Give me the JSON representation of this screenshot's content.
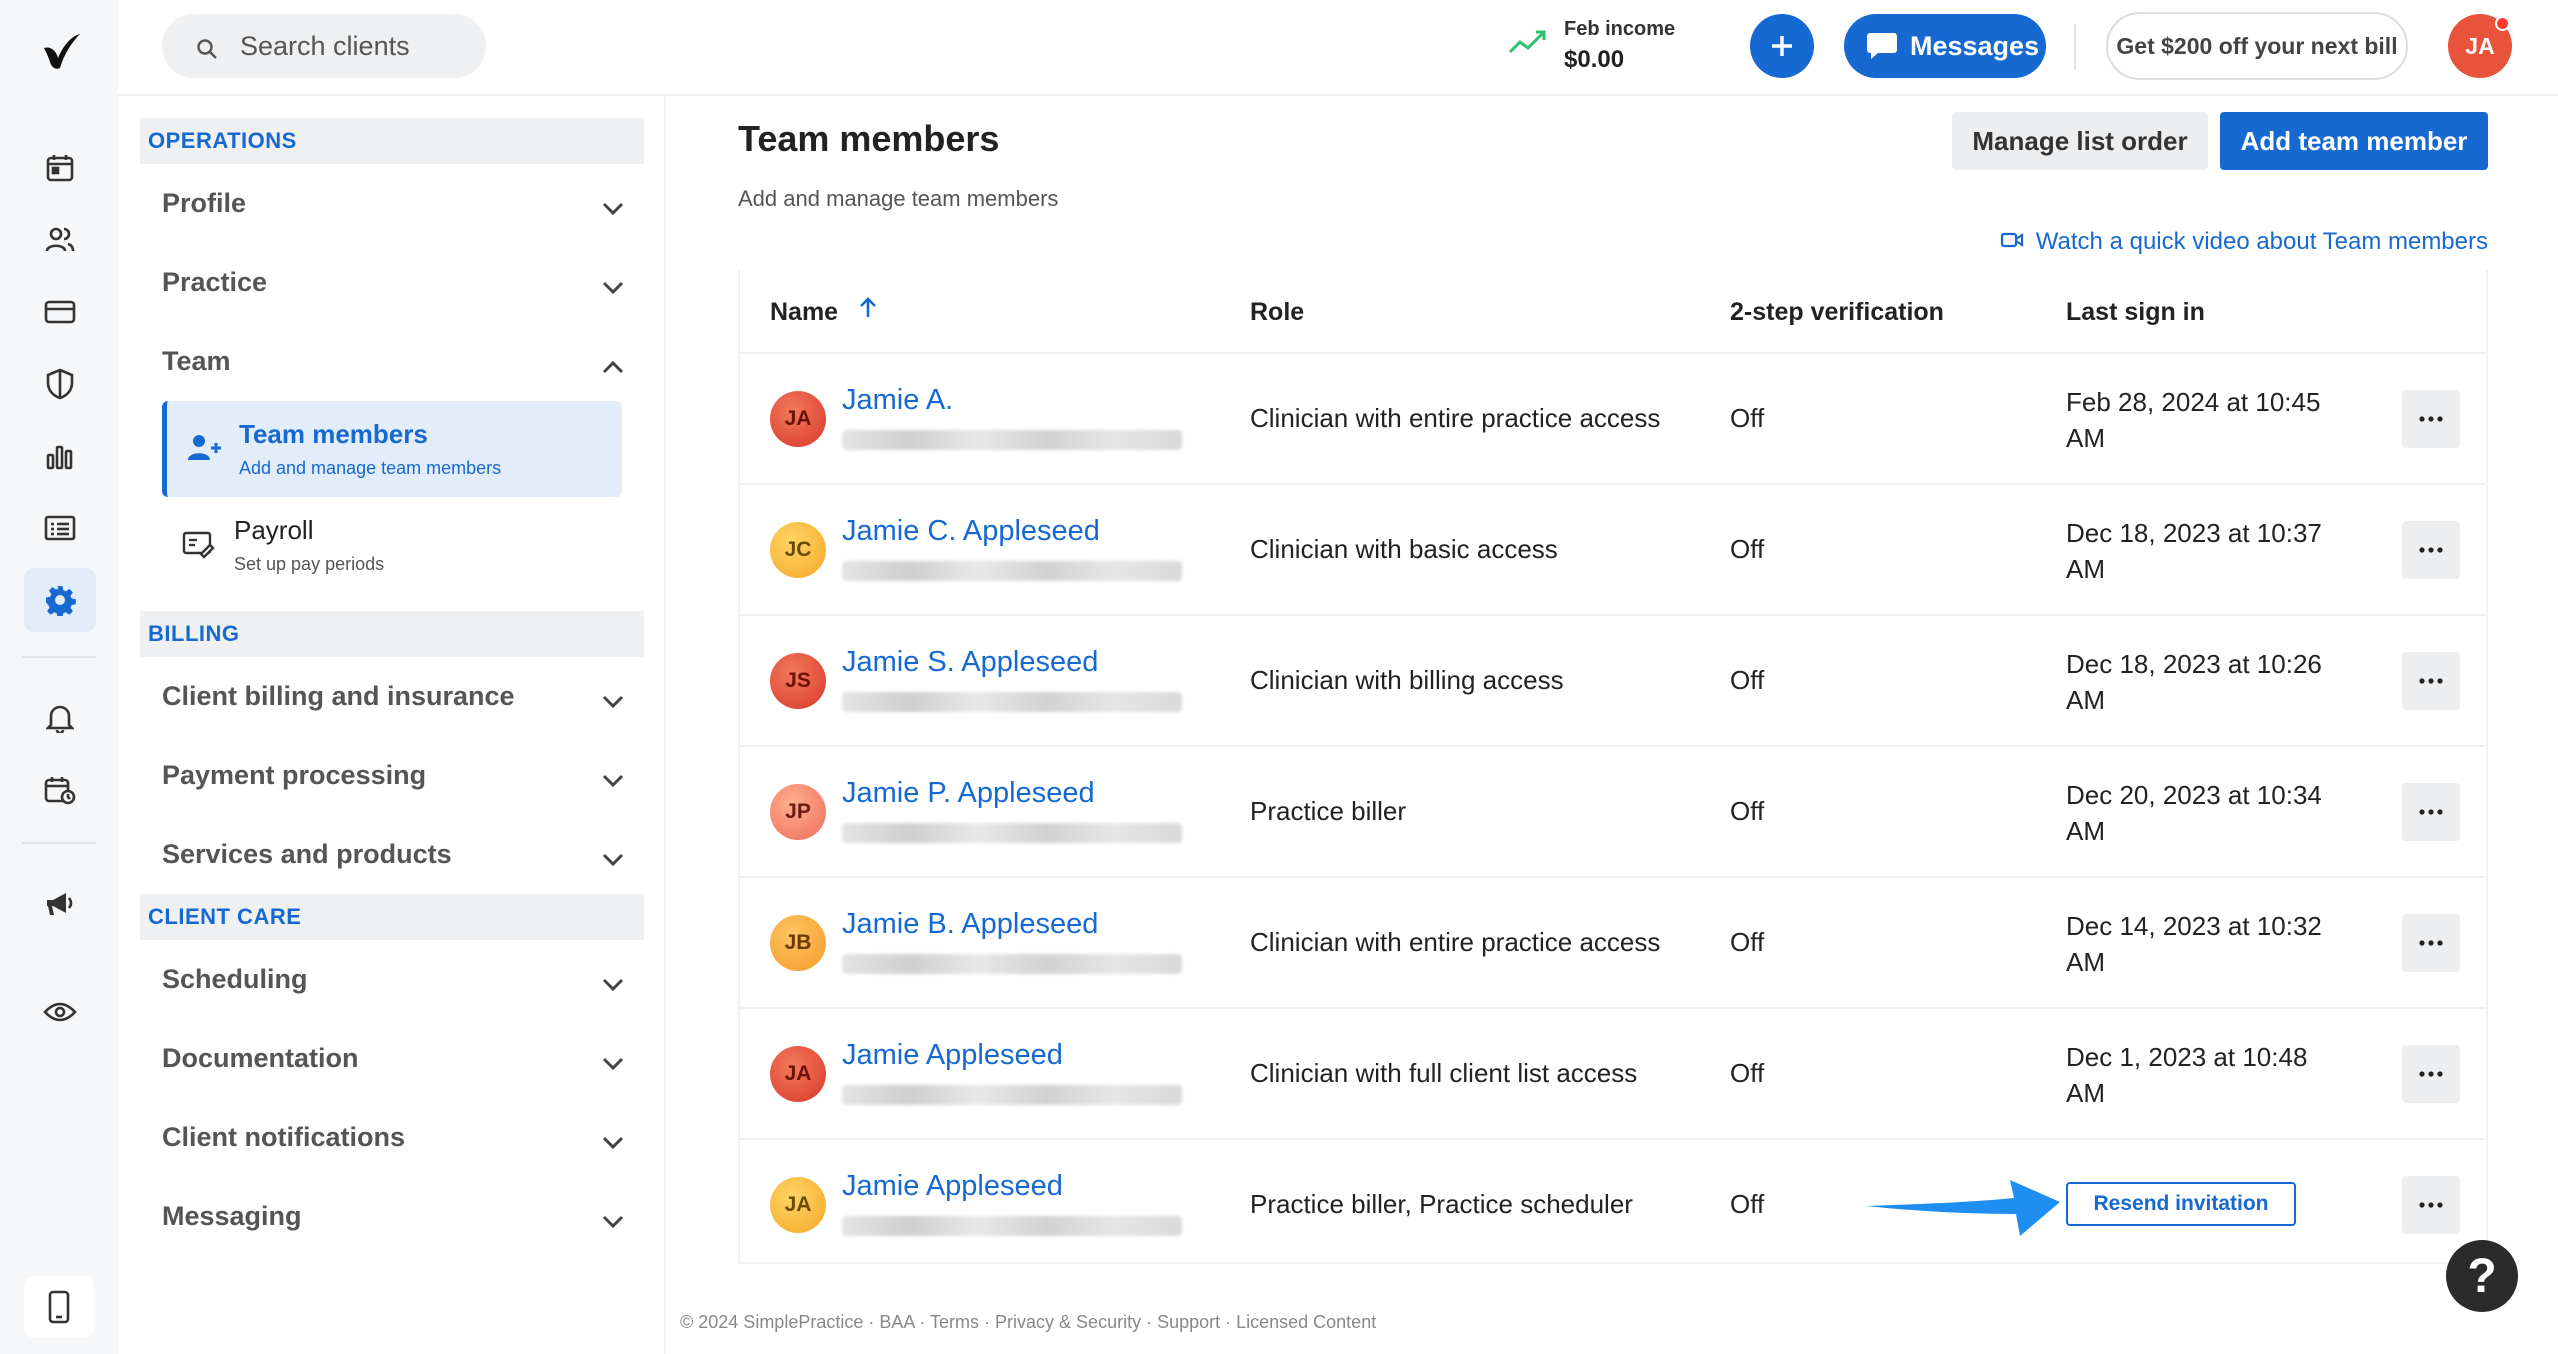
{
  "colors": {
    "accent": "#1669d0",
    "rail_bg": "#f6f7f8",
    "income_trend": "#2fbf71"
  },
  "rail": {
    "icons": [
      "logo-icon",
      "calendar-icon",
      "clients-icon",
      "billing-card-icon",
      "insurance-shield-icon",
      "analytics-icon",
      "list-icon",
      "settings-gear-icon",
      "bell-icon",
      "calendar-request-icon",
      "megaphone-icon",
      "eye-icon",
      "mobile-phone-icon"
    ],
    "active": "settings-gear-icon"
  },
  "topbar": {
    "search_placeholder": "Search clients",
    "income_label": "Feb income",
    "income_value": "$0.00",
    "messages_label": "Messages",
    "promo_label": "Get $200 off your next bill",
    "user_initials": "JA"
  },
  "nav": {
    "operations_label": "OPERATIONS",
    "profile": "Profile",
    "practice": "Practice",
    "team": "Team",
    "team_members_title": "Team members",
    "team_members_desc": "Add and manage team members",
    "payroll_title": "Payroll",
    "payroll_desc": "Set up pay periods",
    "billing_label": "BILLING",
    "client_billing": "Client billing and insurance",
    "payment_processing": "Payment processing",
    "services_products": "Services and products",
    "client_care_label": "CLIENT CARE",
    "scheduling": "Scheduling",
    "documentation": "Documentation",
    "client_notifications": "Client notifications",
    "messaging": "Messaging"
  },
  "main": {
    "title": "Team members",
    "subtitle": "Add and manage team members",
    "manage_order_label": "Manage list order",
    "add_member_label": "Add team member",
    "video_link": "Watch a quick video about Team members",
    "columns": {
      "name": "Name",
      "role": "Role",
      "tsv": "2-step verification",
      "last_sign_in": "Last sign in"
    },
    "rows": [
      {
        "initials": "JA",
        "name": "Jamie A.",
        "role": "Clinician with entire practice access",
        "tsv": "Off",
        "signin_line1": "Feb 28, 2024 at 10:45",
        "signin_line2": "AM"
      },
      {
        "initials": "JC",
        "name": "Jamie C. Appleseed",
        "role": "Clinician with basic access",
        "tsv": "Off",
        "signin_line1": "Dec 18, 2023 at 10:37",
        "signin_line2": "AM"
      },
      {
        "initials": "JS",
        "name": "Jamie S. Appleseed",
        "role": "Clinician with billing access",
        "tsv": "Off",
        "signin_line1": "Dec 18, 2023 at 10:26",
        "signin_line2": "AM"
      },
      {
        "initials": "JP",
        "name": "Jamie P. Appleseed",
        "role": "Practice biller",
        "tsv": "Off",
        "signin_line1": "Dec 20, 2023 at 10:34",
        "signin_line2": "AM"
      },
      {
        "initials": "JB",
        "name": "Jamie B. Appleseed",
        "role": "Clinician with entire practice access",
        "tsv": "Off",
        "signin_line1": "Dec 14, 2023 at 10:32",
        "signin_line2": "AM"
      },
      {
        "initials": "JA",
        "name": "Jamie Appleseed",
        "role": "Clinician with full client list access",
        "tsv": "Off",
        "signin_line1": "Dec 1, 2023 at 10:48",
        "signin_line2": "AM"
      },
      {
        "initials": "JA",
        "name": "Jamie Appleseed",
        "role": "Practice biller, Practice scheduler",
        "tsv": "Off",
        "resend_label": "Resend invitation"
      }
    ]
  },
  "footer": "© 2024 SimplePractice · BAA · Terms · Privacy & Security · Support · Licensed Content",
  "help_label": "?"
}
